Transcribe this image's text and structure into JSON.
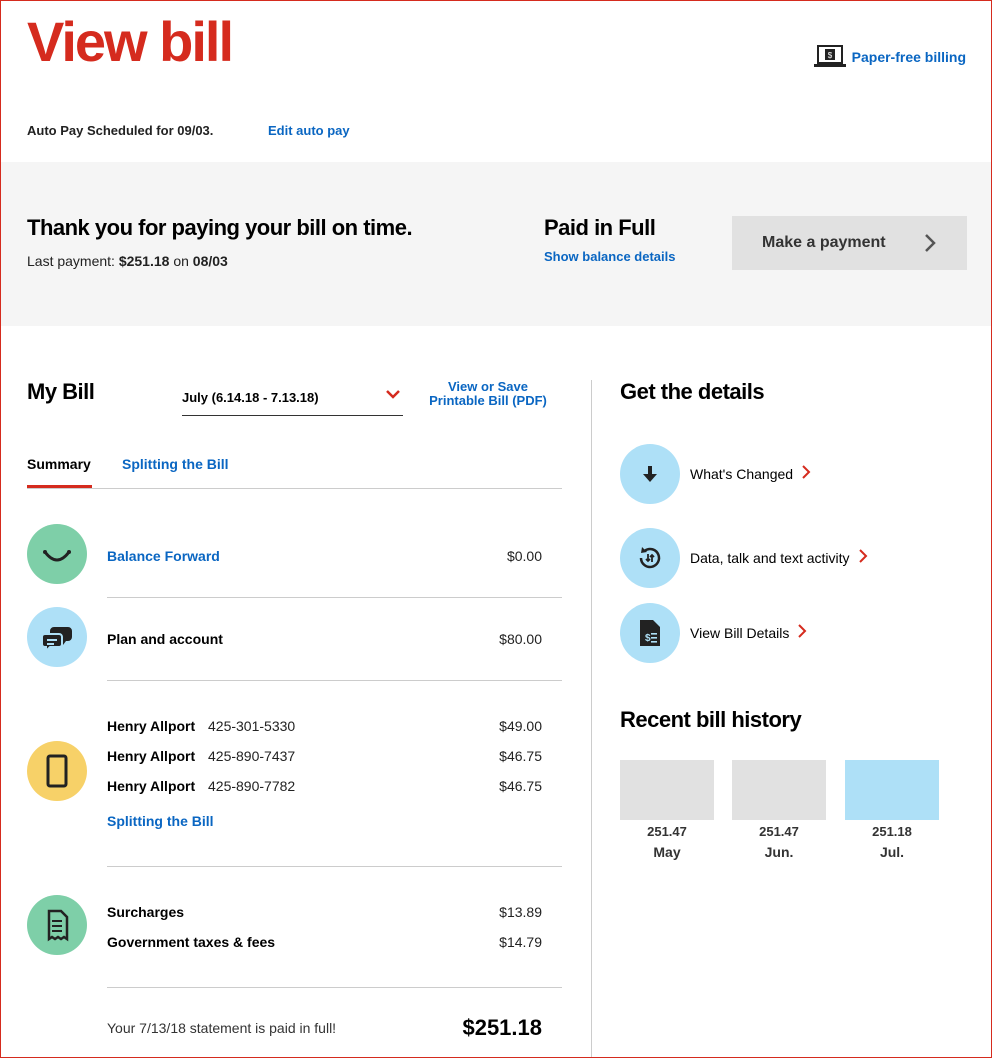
{
  "header": {
    "title": "View bill",
    "paper_free": "Paper-free billing",
    "autopay_text": "Auto Pay Scheduled for 09/03.",
    "edit_autopay": "Edit auto pay"
  },
  "banner": {
    "thanks": "Thank you for paying your bill on time.",
    "last_payment_prefix": "Last payment: ",
    "last_payment_amount": "$251.18",
    "last_payment_on": " on ",
    "last_payment_date": "08/03",
    "paid_status": "Paid in Full",
    "show_balance": "Show balance details",
    "make_payment": "Make a payment"
  },
  "my_bill": {
    "title": "My Bill",
    "period": "July (6.14.18 - 7.13.18)",
    "pdf_line1": "View or Save",
    "pdf_line2": "Printable Bill (PDF)",
    "tabs": [
      "Summary",
      "Splitting the Bill"
    ],
    "balance_forward": {
      "label": "Balance Forward",
      "amount": "$0.00"
    },
    "plan_account": {
      "label": "Plan and account",
      "amount": "$80.00"
    },
    "lines": [
      {
        "name": "Henry Allport",
        "number": "425-301-5330",
        "amount": "$49.00"
      },
      {
        "name": "Henry Allport",
        "number": "425-890-7437",
        "amount": "$46.75"
      },
      {
        "name": "Henry Allport",
        "number": "425-890-7782",
        "amount": "$46.75"
      }
    ],
    "splitting_link": "Splitting the Bill",
    "surcharges": {
      "label": "Surcharges",
      "amount": "$13.89"
    },
    "taxes": {
      "label": "Government taxes & fees",
      "amount": "$14.79"
    },
    "paid_note": "Your 7/13/18 statement is paid in full!",
    "total": "$251.18"
  },
  "details": {
    "title": "Get the details",
    "items": [
      {
        "label": "What's Changed",
        "icon": "down-arrow-icon"
      },
      {
        "label": "Data, talk and text activity",
        "icon": "activity-icon"
      },
      {
        "label": "View Bill Details",
        "icon": "bill-document-icon"
      }
    ]
  },
  "history": {
    "title": "Recent bill history",
    "bars": [
      {
        "value": "251.47",
        "month": "May",
        "color": "#e1e1e1"
      },
      {
        "value": "251.47",
        "month": "Jun.",
        "color": "#e1e1e1"
      },
      {
        "value": "251.18",
        "month": "Jul.",
        "color": "#aee0f7"
      }
    ]
  },
  "colors": {
    "brand_red": "#d52b1e",
    "link_blue": "#0a66c2",
    "banner_bg": "#f5f5f5"
  }
}
